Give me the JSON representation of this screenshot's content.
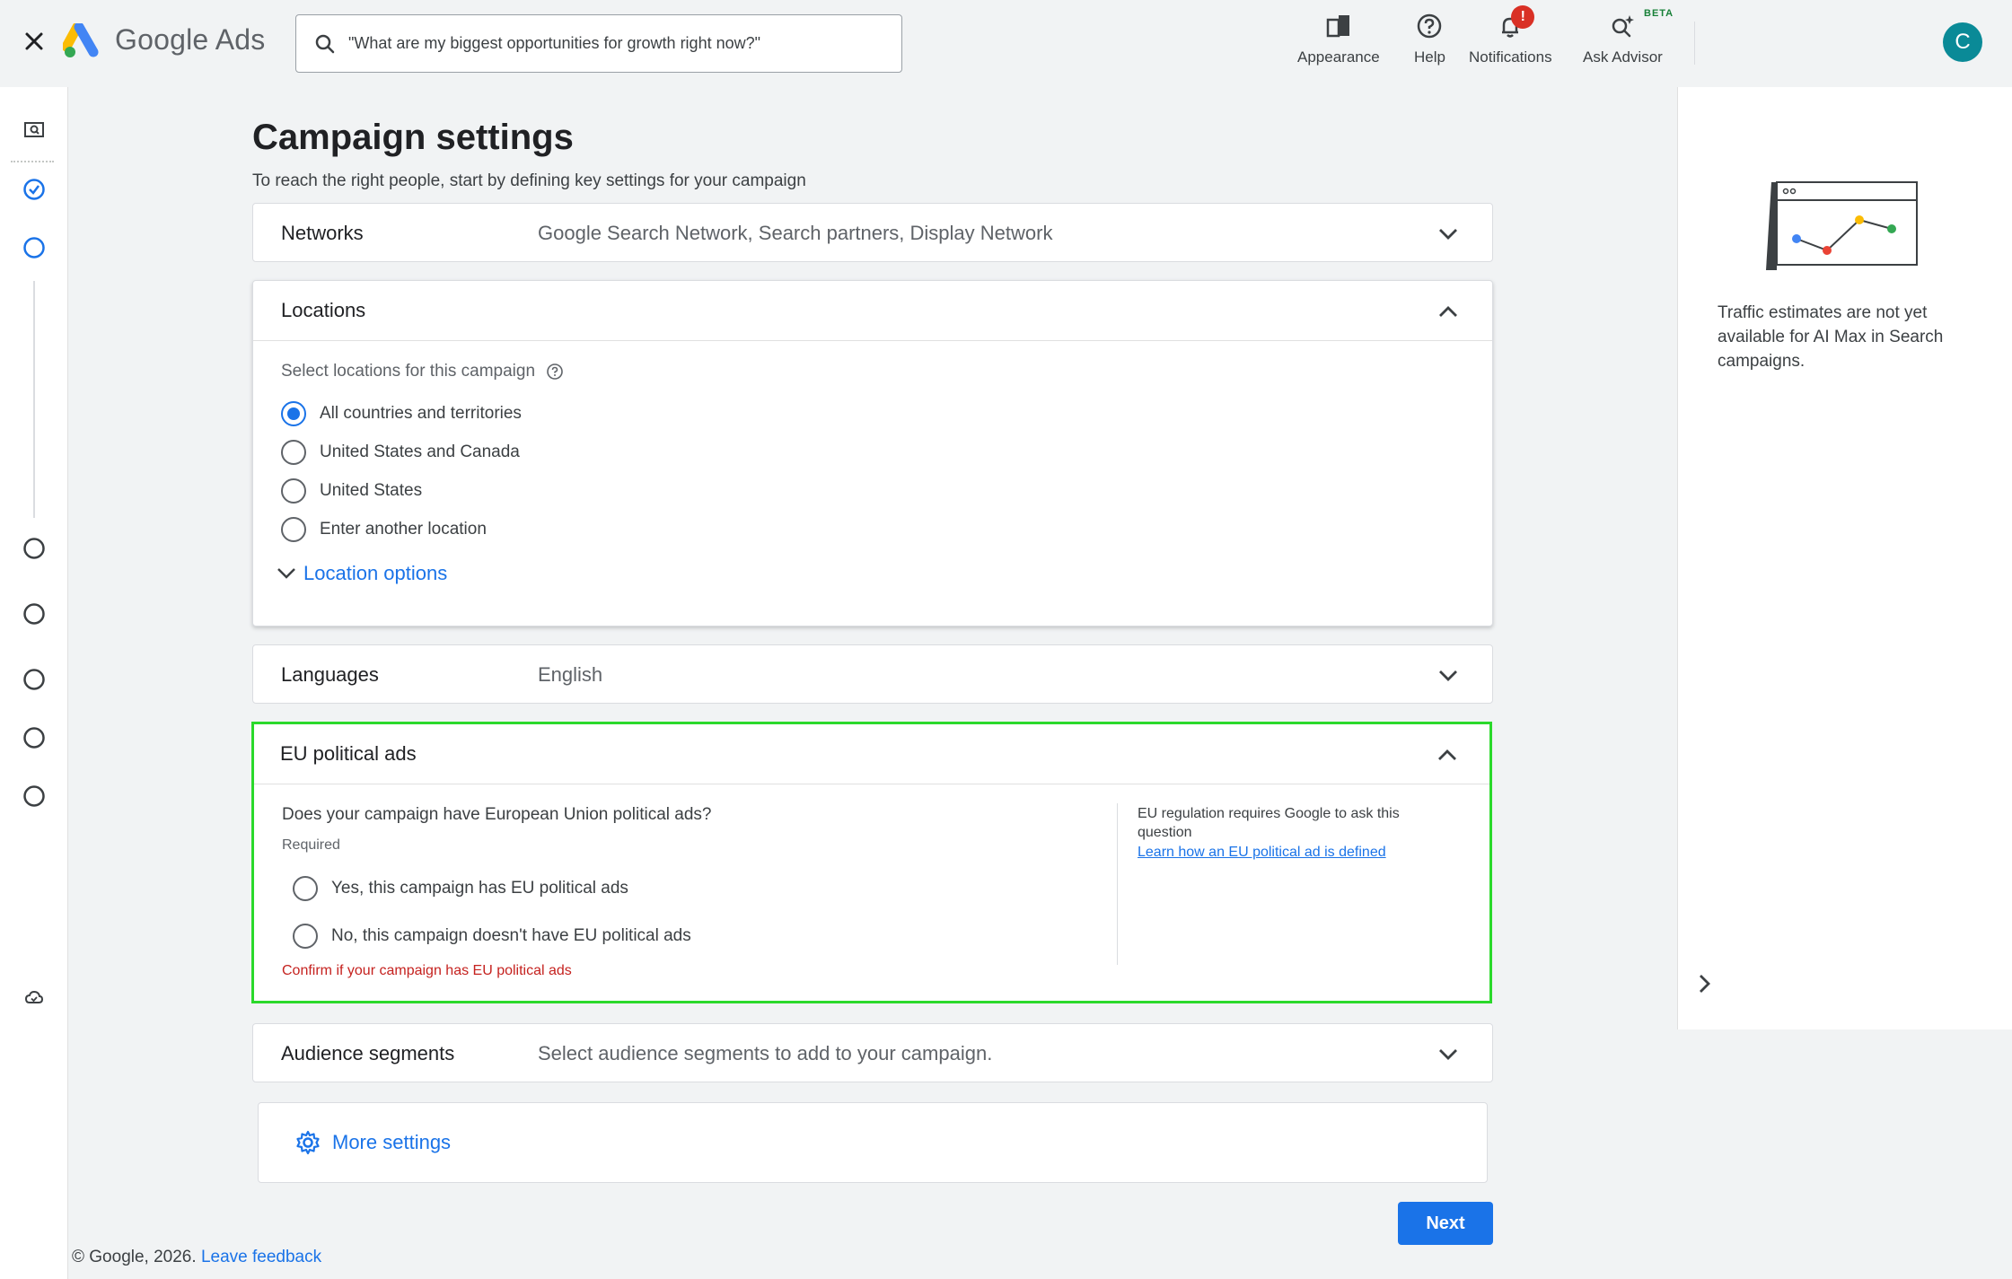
{
  "header": {
    "brand": "Google Ads",
    "search_placeholder": "\"What are my biggest opportunities for growth right now?\"",
    "tools": [
      {
        "label": "Appearance",
        "icon": "appearance-icon"
      },
      {
        "label": "Help",
        "icon": "help-icon"
      },
      {
        "label": "Notifications",
        "icon": "bell-icon",
        "badge": "!"
      },
      {
        "label": "Ask Advisor",
        "icon": "advisor-icon",
        "tag": "BETA"
      }
    ],
    "avatar_initial": "C"
  },
  "page": {
    "title": "Campaign settings",
    "subtitle": "To reach the right people, start by defining key settings for your campaign"
  },
  "networks": {
    "title": "Networks",
    "summary": "Google Search Network, Search partners, Display Network"
  },
  "locations": {
    "title": "Locations",
    "prompt": "Select locations for this campaign",
    "options": [
      {
        "label": "All countries and territories",
        "selected": true
      },
      {
        "label": "United States and Canada",
        "selected": false
      },
      {
        "label": "United States",
        "selected": false
      },
      {
        "label": "Enter another location",
        "selected": false
      }
    ],
    "more_options": "Location options"
  },
  "languages": {
    "title": "Languages",
    "summary": "English"
  },
  "eu_political": {
    "title": "EU political ads",
    "question": "Does your campaign have European Union political ads?",
    "required": "Required",
    "options": [
      {
        "label": "Yes, this campaign has EU political ads",
        "selected": false
      },
      {
        "label": "No, this campaign doesn't have EU political ads",
        "selected": false
      }
    ],
    "error": "Confirm if your campaign has EU political ads",
    "info": "EU regulation requires Google to ask this question",
    "info_link": "Learn how an EU political ad is defined"
  },
  "audience": {
    "title": "Audience segments",
    "summary": "Select audience segments to add to your campaign."
  },
  "more_settings": "More settings",
  "next_label": "Next",
  "footer": {
    "copyright": "© Google, 2026.",
    "feedback": "Leave feedback"
  },
  "side_panel": {
    "message": "Traffic estimates are not yet available for AI Max in Search campaigns."
  },
  "colors": {
    "accent": "#1a73e8",
    "error": "#c5221f",
    "highlight": "#2bd92b",
    "avatar": "#0a8a97"
  }
}
